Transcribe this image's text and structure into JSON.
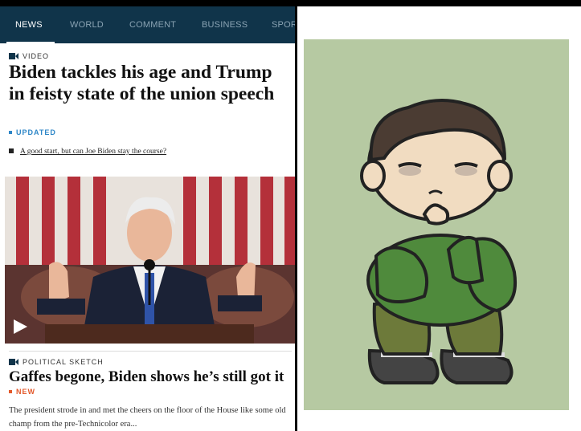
{
  "nav": {
    "tabs": [
      {
        "label": "NEWS",
        "active": true
      },
      {
        "label": "WORLD",
        "active": false
      },
      {
        "label": "COMMENT",
        "active": false
      },
      {
        "label": "BUSINESS",
        "active": false
      },
      {
        "label": "SPOR",
        "active": false
      }
    ]
  },
  "story1": {
    "kicker": "VIDEO",
    "headline": "Biden tackles his age and Trump in feisty state of the union speech",
    "status": "UPDATED",
    "related_link": "A good start, but can Joe Biden stay the course?"
  },
  "story2": {
    "kicker": "POLITICAL SKETCH",
    "headline": "Gaffes begone, Biden shows he’s still got it",
    "status": "NEW",
    "summary": "The president strode in and met the cheers on the floor of the House like some old champ from the pre-Technicolor era..."
  },
  "colors": {
    "nav_bg": "#10344a",
    "updated": "#2d86c7",
    "new": "#e3592b",
    "art_bg": "#b6c9a2"
  },
  "icons": [
    "video-icon",
    "play-icon",
    "square-bullet-icon"
  ]
}
